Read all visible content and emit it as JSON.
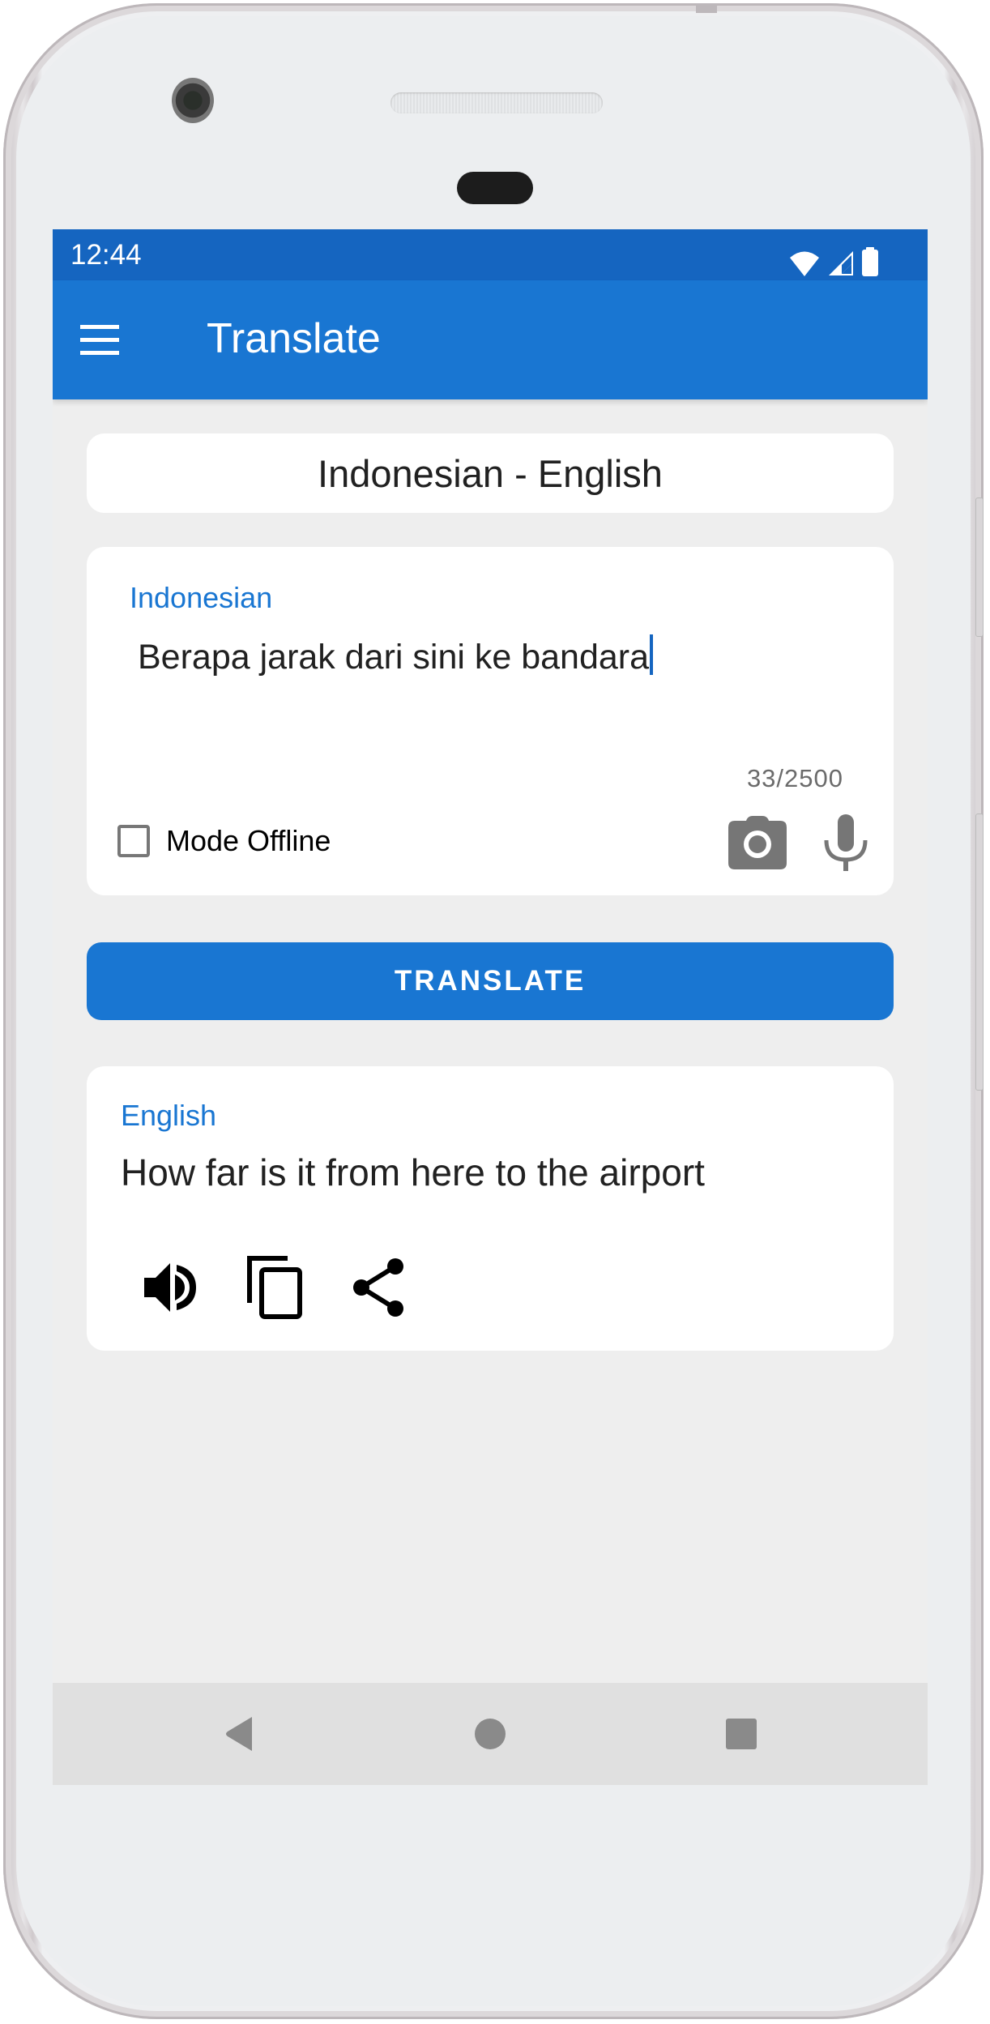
{
  "status_bar": {
    "time": "12:44",
    "icons": [
      "wifi-icon",
      "cellular-signal-icon",
      "battery-icon"
    ]
  },
  "toolbar": {
    "menu_icon": "hamburger-menu-icon",
    "title": "Translate"
  },
  "language_pair": {
    "label": "Indonesian - English"
  },
  "input_card": {
    "source_language": "Indonesian",
    "text": "Berapa jarak dari sini ke bandara",
    "char_count": "33/2500",
    "offline_mode": {
      "label": "Mode Offline",
      "checked": false
    },
    "camera_icon": "camera-icon",
    "mic_icon": "microphone-icon"
  },
  "translate_button": {
    "label": "TRANSLATE"
  },
  "output_card": {
    "target_language": "English",
    "text": "How far is it from here to the airport",
    "actions": [
      "speaker-icon",
      "copy-icon",
      "share-icon"
    ]
  },
  "nav_bar": {
    "buttons": [
      "back",
      "home",
      "recents"
    ]
  },
  "colors": {
    "primary": "#1976d2",
    "primary_dark": "#1565c0",
    "background": "#eeeeee",
    "card": "#ffffff",
    "icon_gray": "#767676",
    "nav_bar": "#e0e0e0"
  }
}
